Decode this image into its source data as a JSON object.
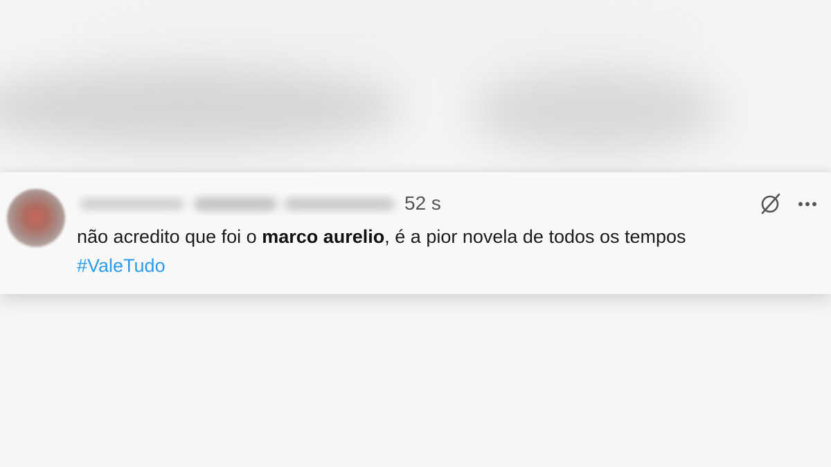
{
  "tweet": {
    "timestamp": "52 s",
    "text_part1": "não acredito que foi o ",
    "text_bold": "marco aurelio",
    "text_part2": ", é a pior novela de todos os tempos",
    "hashtag": "#ValeTudo"
  },
  "icons": {
    "grok": "grok-icon",
    "more": "more-options-icon",
    "avatar": "avatar"
  },
  "colors": {
    "hashtag": "#2c9bf0",
    "background": "#f5f5f5",
    "card": "#f8f8f8"
  }
}
